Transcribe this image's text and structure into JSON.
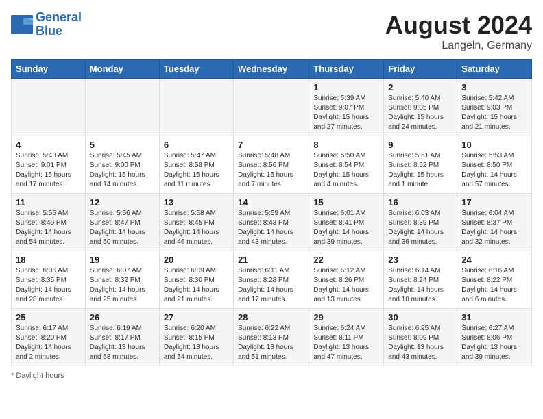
{
  "header": {
    "logo_line1": "General",
    "logo_line2": "Blue",
    "month_year": "August 2024",
    "location": "Langeln, Germany"
  },
  "days_of_week": [
    "Sunday",
    "Monday",
    "Tuesday",
    "Wednesday",
    "Thursday",
    "Friday",
    "Saturday"
  ],
  "weeks": [
    [
      {
        "num": "",
        "detail": ""
      },
      {
        "num": "",
        "detail": ""
      },
      {
        "num": "",
        "detail": ""
      },
      {
        "num": "",
        "detail": ""
      },
      {
        "num": "1",
        "detail": "Sunrise: 5:39 AM\nSunset: 9:07 PM\nDaylight: 15 hours\nand 27 minutes."
      },
      {
        "num": "2",
        "detail": "Sunrise: 5:40 AM\nSunset: 9:05 PM\nDaylight: 15 hours\nand 24 minutes."
      },
      {
        "num": "3",
        "detail": "Sunrise: 5:42 AM\nSunset: 9:03 PM\nDaylight: 15 hours\nand 21 minutes."
      }
    ],
    [
      {
        "num": "4",
        "detail": "Sunrise: 5:43 AM\nSunset: 9:01 PM\nDaylight: 15 hours\nand 17 minutes."
      },
      {
        "num": "5",
        "detail": "Sunrise: 5:45 AM\nSunset: 9:00 PM\nDaylight: 15 hours\nand 14 minutes."
      },
      {
        "num": "6",
        "detail": "Sunrise: 5:47 AM\nSunset: 8:58 PM\nDaylight: 15 hours\nand 11 minutes."
      },
      {
        "num": "7",
        "detail": "Sunrise: 5:48 AM\nSunset: 8:56 PM\nDaylight: 15 hours\nand 7 minutes."
      },
      {
        "num": "8",
        "detail": "Sunrise: 5:50 AM\nSunset: 8:54 PM\nDaylight: 15 hours\nand 4 minutes."
      },
      {
        "num": "9",
        "detail": "Sunrise: 5:51 AM\nSunset: 8:52 PM\nDaylight: 15 hours\nand 1 minute."
      },
      {
        "num": "10",
        "detail": "Sunrise: 5:53 AM\nSunset: 8:50 PM\nDaylight: 14 hours\nand 57 minutes."
      }
    ],
    [
      {
        "num": "11",
        "detail": "Sunrise: 5:55 AM\nSunset: 8:49 PM\nDaylight: 14 hours\nand 54 minutes."
      },
      {
        "num": "12",
        "detail": "Sunrise: 5:56 AM\nSunset: 8:47 PM\nDaylight: 14 hours\nand 50 minutes."
      },
      {
        "num": "13",
        "detail": "Sunrise: 5:58 AM\nSunset: 8:45 PM\nDaylight: 14 hours\nand 46 minutes."
      },
      {
        "num": "14",
        "detail": "Sunrise: 5:59 AM\nSunset: 8:43 PM\nDaylight: 14 hours\nand 43 minutes."
      },
      {
        "num": "15",
        "detail": "Sunrise: 6:01 AM\nSunset: 8:41 PM\nDaylight: 14 hours\nand 39 minutes."
      },
      {
        "num": "16",
        "detail": "Sunrise: 6:03 AM\nSunset: 8:39 PM\nDaylight: 14 hours\nand 36 minutes."
      },
      {
        "num": "17",
        "detail": "Sunrise: 6:04 AM\nSunset: 8:37 PM\nDaylight: 14 hours\nand 32 minutes."
      }
    ],
    [
      {
        "num": "18",
        "detail": "Sunrise: 6:06 AM\nSunset: 8:35 PM\nDaylight: 14 hours\nand 28 minutes."
      },
      {
        "num": "19",
        "detail": "Sunrise: 6:07 AM\nSunset: 8:32 PM\nDaylight: 14 hours\nand 25 minutes."
      },
      {
        "num": "20",
        "detail": "Sunrise: 6:09 AM\nSunset: 8:30 PM\nDaylight: 14 hours\nand 21 minutes."
      },
      {
        "num": "21",
        "detail": "Sunrise: 6:11 AM\nSunset: 8:28 PM\nDaylight: 14 hours\nand 17 minutes."
      },
      {
        "num": "22",
        "detail": "Sunrise: 6:12 AM\nSunset: 8:26 PM\nDaylight: 14 hours\nand 13 minutes."
      },
      {
        "num": "23",
        "detail": "Sunrise: 6:14 AM\nSunset: 8:24 PM\nDaylight: 14 hours\nand 10 minutes."
      },
      {
        "num": "24",
        "detail": "Sunrise: 6:16 AM\nSunset: 8:22 PM\nDaylight: 14 hours\nand 6 minutes."
      }
    ],
    [
      {
        "num": "25",
        "detail": "Sunrise: 6:17 AM\nSunset: 8:20 PM\nDaylight: 14 hours\nand 2 minutes."
      },
      {
        "num": "26",
        "detail": "Sunrise: 6:19 AM\nSunset: 8:17 PM\nDaylight: 13 hours\nand 58 minutes."
      },
      {
        "num": "27",
        "detail": "Sunrise: 6:20 AM\nSunset: 8:15 PM\nDaylight: 13 hours\nand 54 minutes."
      },
      {
        "num": "28",
        "detail": "Sunrise: 6:22 AM\nSunset: 8:13 PM\nDaylight: 13 hours\nand 51 minutes."
      },
      {
        "num": "29",
        "detail": "Sunrise: 6:24 AM\nSunset: 8:11 PM\nDaylight: 13 hours\nand 47 minutes."
      },
      {
        "num": "30",
        "detail": "Sunrise: 6:25 AM\nSunset: 8:09 PM\nDaylight: 13 hours\nand 43 minutes."
      },
      {
        "num": "31",
        "detail": "Sunrise: 6:27 AM\nSunset: 8:06 PM\nDaylight: 13 hours\nand 39 minutes."
      }
    ]
  ],
  "footer": "Daylight hours"
}
